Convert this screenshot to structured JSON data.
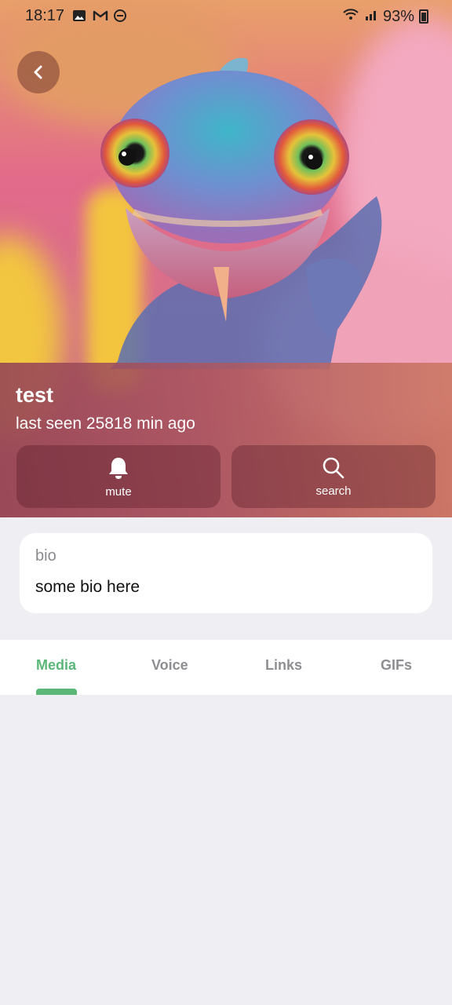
{
  "status_bar": {
    "time": "18:17",
    "battery": "93%",
    "left_icons": [
      "gallery-icon",
      "gmail-icon",
      "do-not-disturb-icon"
    ],
    "right_icons": [
      "wifi-icon",
      "signal-icon",
      "battery-icon"
    ]
  },
  "header": {
    "back_icon": "chevron-left-icon"
  },
  "profile": {
    "name": "test",
    "last_seen": "last seen 25818 min ago"
  },
  "actions": [
    {
      "label": "mute",
      "icon": "bell-icon"
    },
    {
      "label": "search",
      "icon": "search-icon"
    }
  ],
  "bio": {
    "label": "bio",
    "text": "some bio here"
  },
  "tabs": [
    {
      "label": "Media",
      "active": true
    },
    {
      "label": "Voice",
      "active": false
    },
    {
      "label": "Links",
      "active": false
    },
    {
      "label": "GIFs",
      "active": false
    }
  ],
  "colors": {
    "accent": "#5bb777",
    "page_bg": "#efeef3",
    "inactive_tab": "#8e8e92"
  }
}
